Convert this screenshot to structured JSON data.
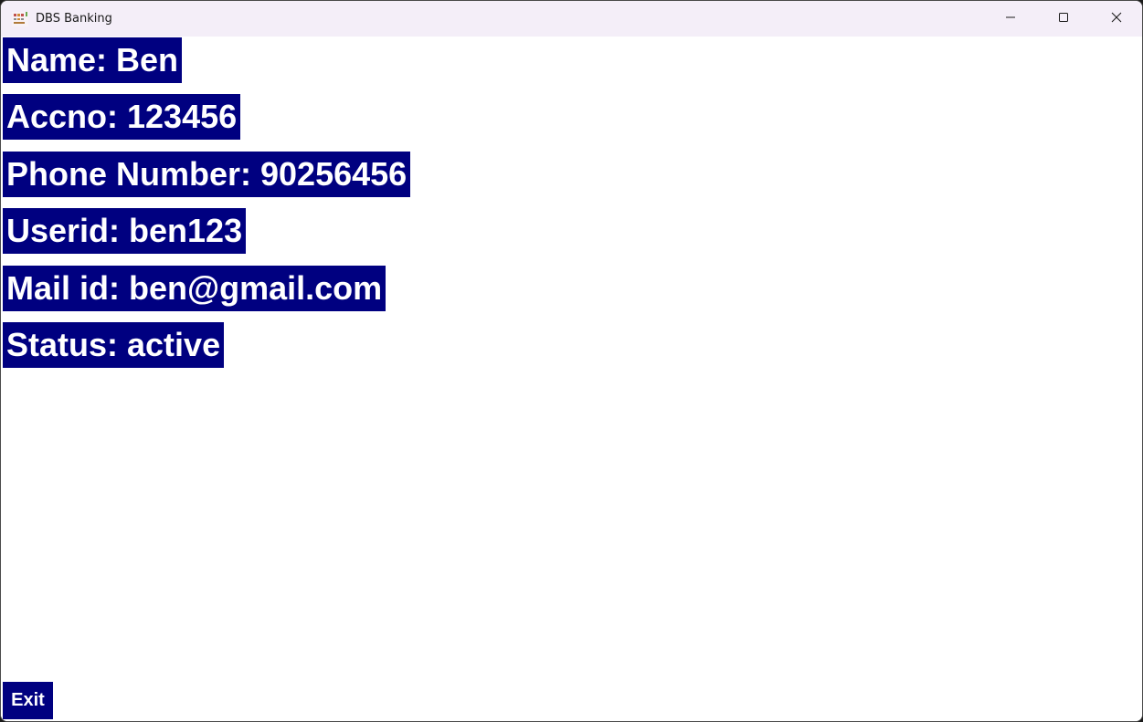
{
  "window": {
    "title": "DBS Banking",
    "icon": "dbs-bank-icon"
  },
  "controls": {
    "minimize_icon": "minimize-icon",
    "maximize_icon": "maximize-icon",
    "close_icon": "close-icon"
  },
  "profile": {
    "name": "Name: Ben",
    "accno": "Accno: 123456",
    "phone": "Phone Number: 90256456",
    "userid": "Userid: ben123",
    "mail": "Mail id: ben@gmail.com",
    "status": "Status: active"
  },
  "actions": {
    "exit_label": "Exit"
  },
  "colors": {
    "label_bg": "#000080",
    "label_text": "#ffffff",
    "titlebar_bg": "#f4eef8"
  }
}
